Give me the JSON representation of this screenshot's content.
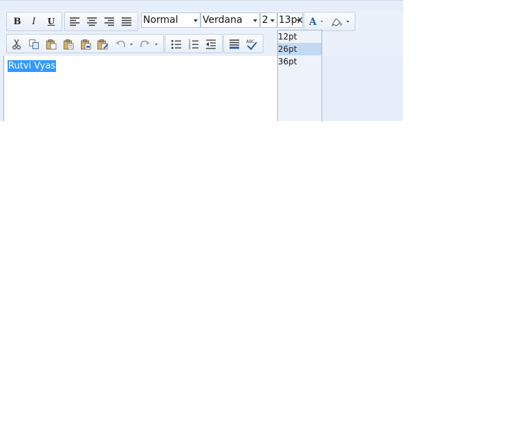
{
  "toolbar": {
    "row1": {
      "bold": "B",
      "italic": "I",
      "underline": "U",
      "format_value": "Normal",
      "font_value": "Verdana",
      "size_value": "2",
      "fontsize_value": "13px"
    },
    "icons": [
      "bold-icon",
      "italic-icon",
      "underline-icon",
      "align-left-icon",
      "align-center-icon",
      "align-right-icon",
      "align-justify-icon",
      "font-color-icon",
      "highlight-icon",
      "cut-icon",
      "copy-icon",
      "paste-icon",
      "paste-text-icon",
      "paste-word-icon",
      "paste-special-icon",
      "undo-icon",
      "redo-icon",
      "bullet-list-icon",
      "numbered-list-icon",
      "outdent-icon",
      "paragraph-icon",
      "spellcheck-icon"
    ]
  },
  "fontsize_dropdown": {
    "items": [
      "12pt",
      "26pt",
      "36pt"
    ],
    "selected": "26pt"
  },
  "editor": {
    "text": "Rutvi Vyas"
  },
  "colors": {
    "selection": "#3399ff",
    "toolbar_bg": "#eaf1fb",
    "dropdown_highlight": "#c3d9f3"
  }
}
